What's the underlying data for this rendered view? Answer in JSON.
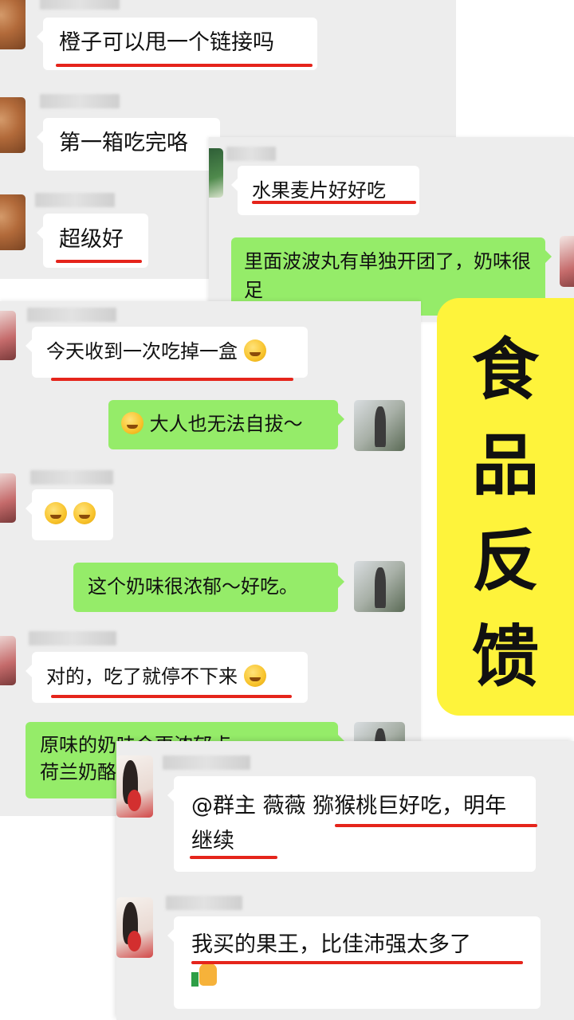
{
  "screenshot_1": {
    "messages": [
      {
        "text": "橙子可以甩一个链接吗"
      },
      {
        "text": "第一箱吃完咯"
      },
      {
        "text": "超级好"
      }
    ]
  },
  "screenshot_2": {
    "messages": [
      {
        "text": "水果麦片好好吃"
      },
      {
        "text": "里面波波丸有单独开团了，奶味很足"
      }
    ]
  },
  "screenshot_3": {
    "messages": [
      {
        "text": "今天收到一次吃掉一盒"
      },
      {
        "text": "大人也无法自拔～"
      },
      {
        "text": ""
      },
      {
        "text": "这个奶味很浓郁～好吃。"
      },
      {
        "text": "对的，吃了就停不下来"
      },
      {
        "text": "原味的奶味会更浓郁点"
      },
      {
        "text": "荷兰奶酪"
      }
    ]
  },
  "screenshot_4": {
    "messages": [
      {
        "text": "@群主 薇薇 猕猴桃巨好吃，明年继续"
      },
      {
        "text": "我买的果王，比佳沛强太多了"
      }
    ]
  },
  "banner": {
    "chars": [
      "食",
      "品",
      "反",
      "馈"
    ]
  },
  "colors": {
    "chat_bg": "#ededed",
    "incoming": "#ffffff",
    "outgoing": "#95ec69",
    "highlight": "#e5241b",
    "banner": "#fef33b"
  },
  "icons": {
    "laugh_cry": "face-with-tears-of-joy-icon",
    "hand_over_mouth": "face-with-hand-over-mouth-icon",
    "thumbs_up": "thumbs-up-icon"
  }
}
